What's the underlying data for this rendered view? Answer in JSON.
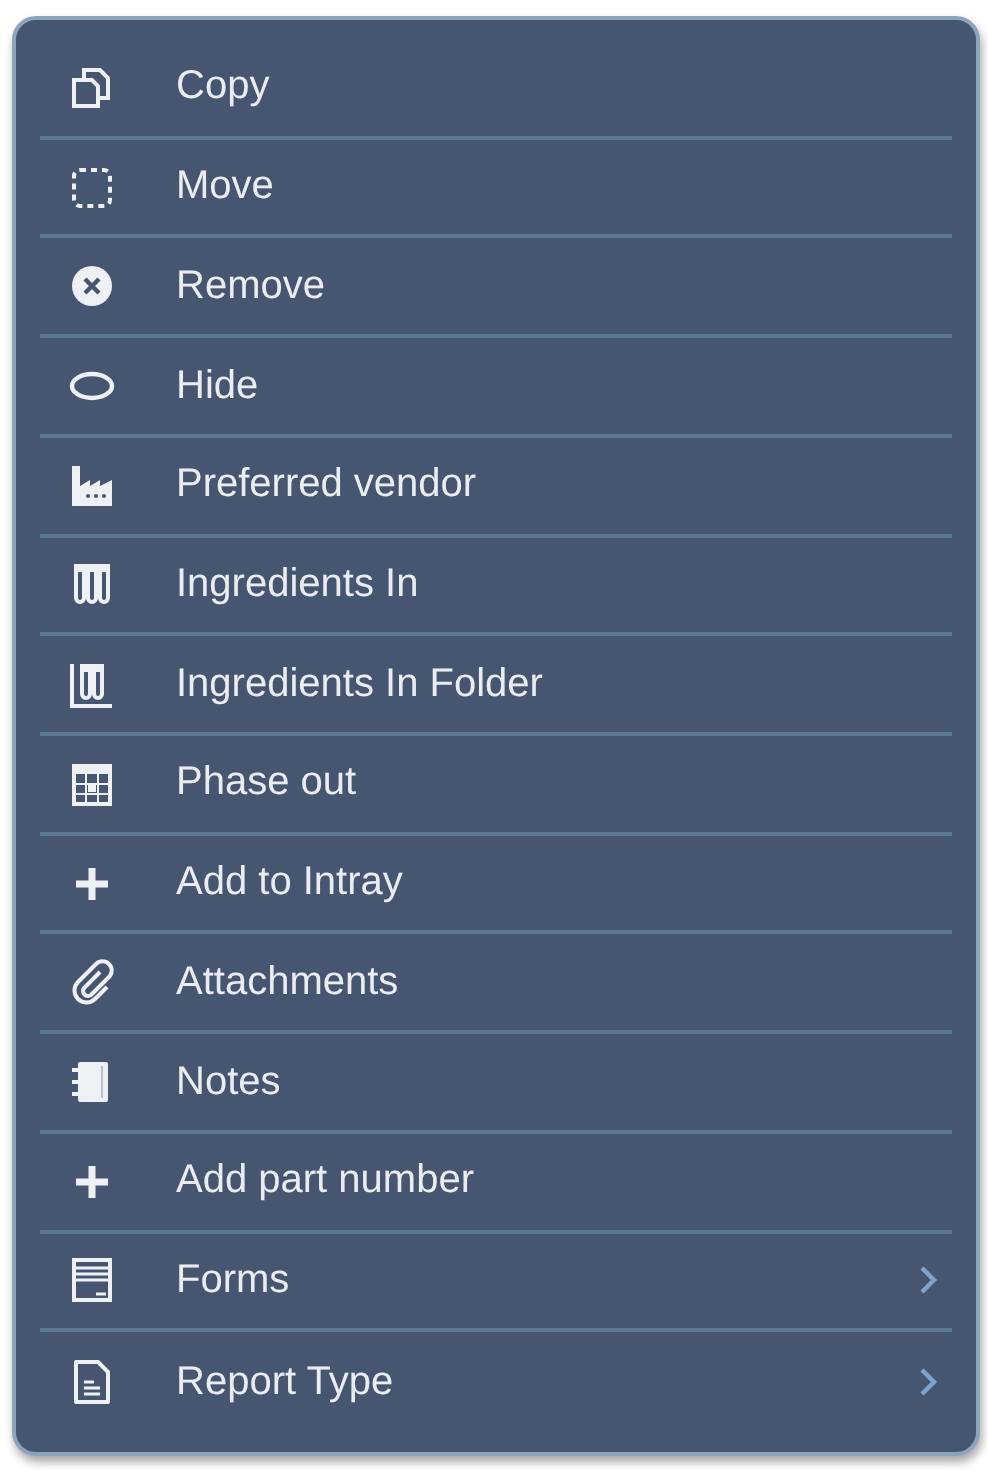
{
  "menu": {
    "items": [
      {
        "label": "Copy",
        "kind": "copy",
        "submenu": false
      },
      {
        "label": "Move",
        "kind": "move",
        "submenu": false
      },
      {
        "label": "Remove",
        "kind": "remove",
        "submenu": false
      },
      {
        "label": "Hide",
        "kind": "hide",
        "submenu": false
      },
      {
        "label": "Preferred vendor",
        "kind": "factory",
        "submenu": false
      },
      {
        "label": "Ingredients In",
        "kind": "tubes",
        "submenu": false
      },
      {
        "label": "Ingredients In Folder",
        "kind": "tubes-folder",
        "submenu": false
      },
      {
        "label": "Phase out",
        "kind": "calendar",
        "submenu": false
      },
      {
        "label": "Add to Intray",
        "kind": "plus",
        "submenu": false
      },
      {
        "label": "Attachments",
        "kind": "paperclip",
        "submenu": false
      },
      {
        "label": "Notes",
        "kind": "notebook",
        "submenu": false
      },
      {
        "label": "Add part number",
        "kind": "plus",
        "submenu": false
      },
      {
        "label": "Forms",
        "kind": "form",
        "submenu": true
      },
      {
        "label": "Report Type",
        "kind": "document",
        "submenu": true
      }
    ]
  }
}
